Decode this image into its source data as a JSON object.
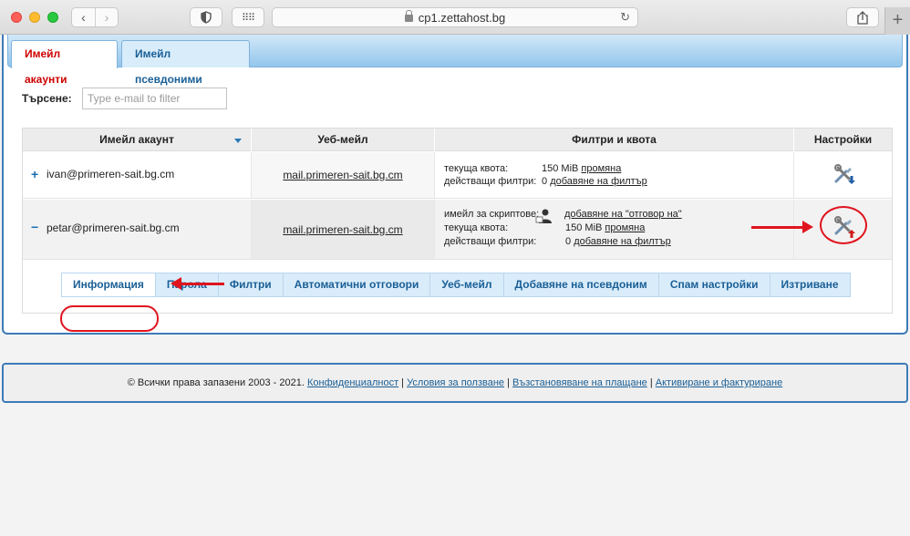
{
  "browser": {
    "url": "cp1.zettahost.bg"
  },
  "tabs": [
    {
      "label": "Имейл акаунти"
    },
    {
      "label": "Имейл псевдоними"
    }
  ],
  "search": {
    "label": "Търсене:",
    "placeholder": "Type e-mail to filter",
    "value": ""
  },
  "table": {
    "headers": [
      "Имейл акаунт",
      "Уеб-мейл",
      "Филтри и квота",
      "Настройки"
    ],
    "rows": [
      {
        "toggle": "+",
        "account": "ivan@primeren-sait.bg.cm",
        "webmail": "mail.primeren-sait.bg.cm",
        "quota_label": "текуща квота:",
        "quota_value": "150 MiB",
        "quota_link": "промяна",
        "filters_label": "действащи филтри:",
        "filters_value": "0",
        "filters_link": "добавяне на филтър"
      },
      {
        "toggle": "−",
        "account": "petar@primeren-sait.bg.cm",
        "webmail": "mail.primeren-sait.bg.cm",
        "script_label": "имейл за скриптове:",
        "script_link": "добавяне на \"отговор на\"",
        "quota_label": "текуща квота:",
        "quota_value": "150 MiB",
        "quota_link": "промяна",
        "filters_label": "действащи филтри:",
        "filters_value": "0",
        "filters_link": "добавяне на филтър"
      }
    ]
  },
  "actions": [
    {
      "label": "Информация"
    },
    {
      "label": "Парола"
    },
    {
      "label": "Филтри"
    },
    {
      "label": "Автоматични отговори"
    },
    {
      "label": "Уеб-мейл"
    },
    {
      "label": "Добавяне на псевдоним"
    },
    {
      "label": "Спам настройки"
    },
    {
      "label": "Изтриване"
    }
  ],
  "footer": {
    "copyright": "© Всички права запазени 2003 - 2021.",
    "links": [
      {
        "label": "Конфиденциалност"
      },
      {
        "label": "Условия за ползване"
      },
      {
        "label": "Възстановяване на плащане"
      },
      {
        "label": "Активиране и фактуриране"
      }
    ],
    "separator": "|"
  },
  "colors": {
    "accent": "#1a5f96",
    "active_tab_text": "#cc0000",
    "annotation": "#e0141e",
    "border": "#3d7ab8"
  }
}
